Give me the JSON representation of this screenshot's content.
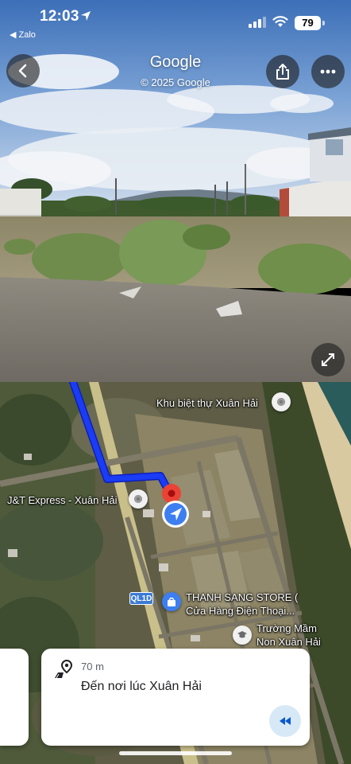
{
  "status_bar": {
    "time": "12:03",
    "back_app": "◀ Zalo",
    "battery": "79"
  },
  "street_view": {
    "title": "Google",
    "subtitle": "© 2025 Google",
    "icons": {
      "back": "chevron-left-icon",
      "share": "share-icon",
      "more": "more-horiz-icon",
      "expand": "expand-diagonal-icon"
    }
  },
  "map": {
    "labels": {
      "villa": "Khu biệt thự Xuân Hải",
      "jt_express": "J&T Express - Xuân Hải",
      "store_line1": "THANH SANG STORE (",
      "store_line2": "Cửa Hàng Điện Thoại...",
      "school_line1": "Trường Mầm",
      "school_line2": "Non Xuân Hải",
      "road_shield": "QL1D"
    },
    "colors": {
      "route": "#1a3cf5",
      "destination_pin": "#ea4335",
      "location_puck": "#3d7ff1"
    }
  },
  "nav_card": {
    "distance": "70 m",
    "destination": "Đến nơi lúc Xuân Hải"
  }
}
